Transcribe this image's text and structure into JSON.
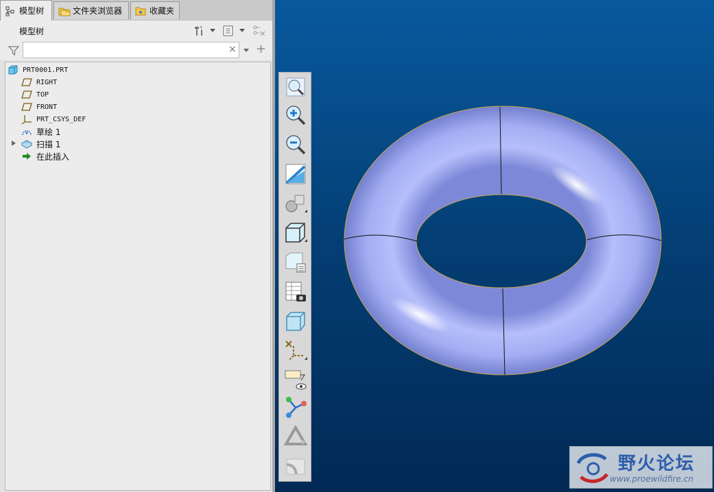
{
  "tabs": [
    {
      "label": "模型树",
      "active": true,
      "icon": "model-tree-icon"
    },
    {
      "label": "文件夹浏览器",
      "active": false,
      "icon": "folder-browser-icon"
    },
    {
      "label": "收藏夹",
      "active": false,
      "icon": "favorites-icon"
    }
  ],
  "tree_panel": {
    "title": "模型树",
    "search": {
      "value": "",
      "placeholder": ""
    },
    "clear_glyph": "×",
    "add_glyph": "+"
  },
  "tree": [
    {
      "label": "PRT0001.PRT",
      "icon": "part-icon",
      "level": 0
    },
    {
      "label": "RIGHT",
      "icon": "datum-plane-icon",
      "level": 1
    },
    {
      "label": "TOP",
      "icon": "datum-plane-icon",
      "level": 1
    },
    {
      "label": "FRONT",
      "icon": "datum-plane-icon",
      "level": 1
    },
    {
      "label": "PRT_CSYS_DEF",
      "icon": "csys-icon",
      "level": 1
    },
    {
      "label": "草绘 1",
      "icon": "sketch-icon",
      "level": 1
    },
    {
      "label": "扫描 1",
      "icon": "sweep-icon",
      "level": 1,
      "expandable": true
    },
    {
      "label": "在此插入",
      "icon": "insert-here-icon",
      "level": 1
    }
  ],
  "view_toolbar": [
    "refit-icon",
    "zoom-in-icon",
    "zoom-out-icon",
    "repaint-icon",
    "display-style-icon",
    "saved-orientations-icon",
    "view-manager-icon",
    "named-views-icon",
    "perspective-icon",
    "datum-display-icon",
    "annotation-display-icon",
    "spin-center-icon",
    "simulation-display-icon",
    "appearance-icon"
  ],
  "colors": {
    "torus": "#a7b1f5",
    "viewport_top": "#08599e",
    "viewport_bottom": "#012955"
  },
  "watermark": {
    "title": "野火论坛",
    "url": "www.proewildfire.cn"
  }
}
